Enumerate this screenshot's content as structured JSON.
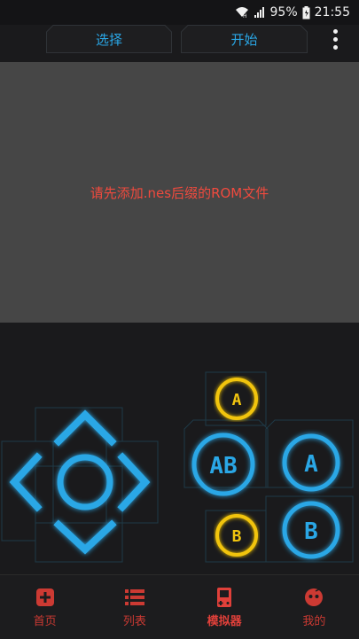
{
  "status": {
    "battery": "95%",
    "time": "21:55"
  },
  "toolbar": {
    "select_label": "选择",
    "start_label": "开始"
  },
  "screen": {
    "message": "请先添加.nes后缀的ROM文件"
  },
  "controller": {
    "button_a_small": "A",
    "button_b_small": "B",
    "button_ab": "AB",
    "button_a": "A",
    "button_b": "B"
  },
  "nav": {
    "items": [
      {
        "label": "首页",
        "icon": "home-plus-icon"
      },
      {
        "label": "列表",
        "icon": "list-icon"
      },
      {
        "label": "模拟器",
        "icon": "gameboy-icon",
        "active": true
      },
      {
        "label": "我的",
        "icon": "profile-face-icon"
      }
    ]
  },
  "colors": {
    "accent": "#2aa7e6",
    "nav_red": "#cc3a33",
    "yellow_button": "#f1c40f",
    "message_red": "#f04a3e",
    "screen_bg": "#464646"
  }
}
